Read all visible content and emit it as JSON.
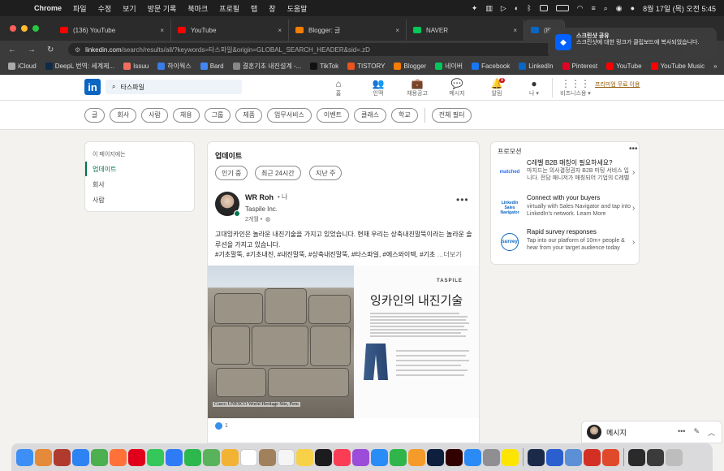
{
  "menubar": {
    "app": "Chrome",
    "items": [
      "파일",
      "수정",
      "보기",
      "방문 기록",
      "북마크",
      "프로필",
      "탭",
      "창",
      "도움말"
    ],
    "clock": "8월 17일 (목) 오전 5:45"
  },
  "tabs": [
    {
      "title": "(136) YouTube",
      "color": "#ff0000"
    },
    {
      "title": "YouTube",
      "color": "#ff0000"
    },
    {
      "title": "Blogger: 글",
      "color": "#f57d00"
    },
    {
      "title": "NAVER",
      "color": "#03c75a"
    },
    {
      "title": "(8)",
      "color": "#0a66c2"
    }
  ],
  "address": {
    "domain": "linkedin.com",
    "path": "/search/results/all/?keywords=타스파일&origin=GLOBAL_SEARCH_HEADER&sid=.zD"
  },
  "bookmarks": [
    {
      "label": "iCloud",
      "color": "#aaaaaa"
    },
    {
      "label": "DeepL 번역: 세계제...",
      "color": "#0f2b46"
    },
    {
      "label": "Issuu",
      "color": "#f36d5d"
    },
    {
      "label": "하이웍스",
      "color": "#3b7be8"
    },
    {
      "label": "Bard",
      "color": "#4285f4"
    },
    {
      "label": "결혼기초 내진설계 -...",
      "color": "#888888"
    },
    {
      "label": "TikTok",
      "color": "#111111"
    },
    {
      "label": "TISTORY",
      "color": "#eb531f"
    },
    {
      "label": "Blogger",
      "color": "#f57d00"
    },
    {
      "label": "네이버",
      "color": "#03c75a"
    },
    {
      "label": "Facebook",
      "color": "#1877f2"
    },
    {
      "label": "LinkedIn",
      "color": "#0a66c2"
    },
    {
      "label": "Pinterest",
      "color": "#e60023"
    },
    {
      "label": "YouTube",
      "color": "#ff0000"
    },
    {
      "label": "YouTube Music",
      "color": "#ff0000"
    }
  ],
  "linkedin": {
    "logo": "in",
    "search_value": "타스파일",
    "nav": [
      {
        "label": "홈",
        "icon": "home-icon",
        "glyph": "⌂"
      },
      {
        "label": "인맥",
        "icon": "people-icon",
        "glyph": "👥"
      },
      {
        "label": "채용공고",
        "icon": "briefcase-icon",
        "glyph": "💼"
      },
      {
        "label": "메시지",
        "icon": "message-icon",
        "glyph": "💬"
      },
      {
        "label": "알림",
        "icon": "bell-icon",
        "glyph": "🔔",
        "badge": "8"
      },
      {
        "label": "나 ▾",
        "icon": "me-avatar-icon",
        "glyph": "●"
      },
      {
        "label": "비즈니스용 ▾",
        "icon": "grid-icon",
        "glyph": "⋮⋮⋮"
      }
    ],
    "premium_link": "프리미엄 무료 이용"
  },
  "filters": [
    "글",
    "회사",
    "사람",
    "채용",
    "그룹",
    "제품",
    "업무서비스",
    "이벤트",
    "클래스",
    "학교",
    "전체 필터"
  ],
  "left_panel": {
    "caption": "이 페이지에는",
    "items": [
      "업데이트",
      "회사",
      "사람"
    ]
  },
  "feed": {
    "title": "업데이트",
    "sort_pills": [
      "인기 중",
      "최근 24시간",
      "지난 주"
    ],
    "post": {
      "author": "WR Roh",
      "degree": "• 나",
      "company": "Taspile Inc.",
      "time": "2개월 •",
      "text": "고대잉카인은 놀라운 내진기술을 가지고 있었습니다. 현재 우리는 상축내진말뚝이라는 놀라운 솔루션을 가지고 있습니다.",
      "tags": "#기초말뚝, #기초내진, #내진말뚝, #상축내진말뚝, #타스파일, #에스와이텍, #기초",
      "see_more": "…더보기",
      "image": {
        "caption": "Cusco UNESCO World Heritage Site, Peru",
        "brand": "TASPILE",
        "headline": "잉카인의 내진기술"
      },
      "reaction_count": "1"
    }
  },
  "promo": {
    "label": "프로모션",
    "items": [
      {
        "logo": "matched",
        "title": "C레벨 B2B 매칭이 필요하세요?",
        "desc": "마치드는 의사결정권자 B2B 미팅 서비스 입니다. 전담 매니저가 매칭되어 기업의 C레벨을 직접 소개해 드립니다.",
        "color": "#2a6df4"
      },
      {
        "logo": "LinkedIn Sales Navigator",
        "title": "Connect with your buyers",
        "desc": "virtually with Sales Navigator and tap into LinkedIn's network. Learn More",
        "color": "#0a66c2"
      },
      {
        "logo": "survey",
        "title": "Rapid survey responses",
        "desc": "Tap into our platform of 10m+ people & hear from your target audience today",
        "color": "#0a66c2"
      }
    ]
  },
  "notification": {
    "title": "스크린샷 공유",
    "body": "스크린샷에 대한 링크가 클립보드에 복사되었습니다."
  },
  "messaging": {
    "label": "메시지"
  },
  "dock": [
    {
      "name": "finder",
      "color": "#3d8ff5"
    },
    {
      "name": "launchpad",
      "color": "#e58a3a"
    },
    {
      "name": "dictionary",
      "color": "#b03a2e"
    },
    {
      "name": "safari",
      "color": "#2d83f2"
    },
    {
      "name": "chrome",
      "color": "#4caf50"
    },
    {
      "name": "firefox",
      "color": "#ff7139"
    },
    {
      "name": "opera",
      "color": "#e0001b"
    },
    {
      "name": "messages",
      "color": "#34c759"
    },
    {
      "name": "mail",
      "color": "#2f7bf5"
    },
    {
      "name": "facetime",
      "color": "#2db84d"
    },
    {
      "name": "maps",
      "color": "#59b35a"
    },
    {
      "name": "photos",
      "color": "#f2b233"
    },
    {
      "name": "calendar",
      "color": "#ffffff"
    },
    {
      "name": "contacts",
      "color": "#a0815c"
    },
    {
      "name": "reminders",
      "color": "#f5f5f5"
    },
    {
      "name": "notes",
      "color": "#f7d147"
    },
    {
      "name": "tv",
      "color": "#1c1c1e"
    },
    {
      "name": "music",
      "color": "#fa3c55"
    },
    {
      "name": "podcasts",
      "color": "#9b4dda"
    },
    {
      "name": "keynote",
      "color": "#2a8cf6"
    },
    {
      "name": "numbers",
      "color": "#2fb54a"
    },
    {
      "name": "pages",
      "color": "#f59b2a"
    },
    {
      "name": "photoshop",
      "color": "#0d1f3d"
    },
    {
      "name": "illustrator",
      "color": "#330000"
    },
    {
      "name": "app-store",
      "color": "#2b8bf6"
    },
    {
      "name": "settings",
      "color": "#8e8e93"
    },
    {
      "name": "kakaotalk",
      "color": "#fee500"
    },
    {
      "name": "app-a",
      "color": "#1c2a4a"
    },
    {
      "name": "app-b",
      "color": "#2a5fd0"
    },
    {
      "name": "preview",
      "color": "#5b8fd6"
    },
    {
      "name": "acrobat",
      "color": "#d42f24"
    },
    {
      "name": "app-c",
      "color": "#e04a2a"
    },
    {
      "name": "screen",
      "color": "#2a2a2a"
    },
    {
      "name": "downloads",
      "color": "#3b3b3b"
    },
    {
      "name": "trash",
      "color": "#bdbdbd"
    }
  ]
}
